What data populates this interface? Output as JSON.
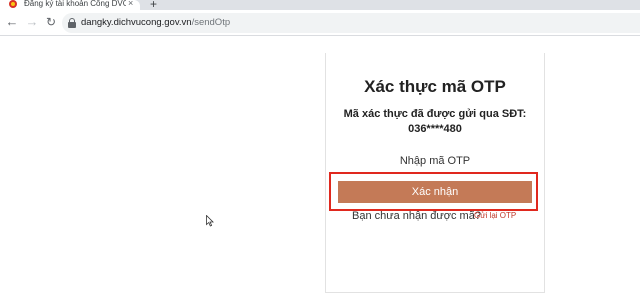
{
  "browser": {
    "tab_title": "Đăng ký tài khoản Cổng DVC quố",
    "tab_close_glyph": "×",
    "new_tab_glyph": "+",
    "url_domain": "dangky.dichvucong.gov.vn",
    "url_path": "/sendOtp"
  },
  "form": {
    "title": "Xác thực mã OTP",
    "description_line1": "Mã xác thực đã được gửi qua SĐT:",
    "phone": "036****480",
    "otp_label": "Nhập mã OTP",
    "otp_values": [
      "",
      "",
      "",
      "",
      "",
      ""
    ],
    "resend_question": "Bạn chưa nhận được mã?",
    "resend_link": "Gửi lại OTP",
    "confirm_label": "Xác nhận"
  },
  "colors": {
    "button": "#c47a57",
    "highlight": "#e0281e",
    "link": "#c0392b"
  }
}
